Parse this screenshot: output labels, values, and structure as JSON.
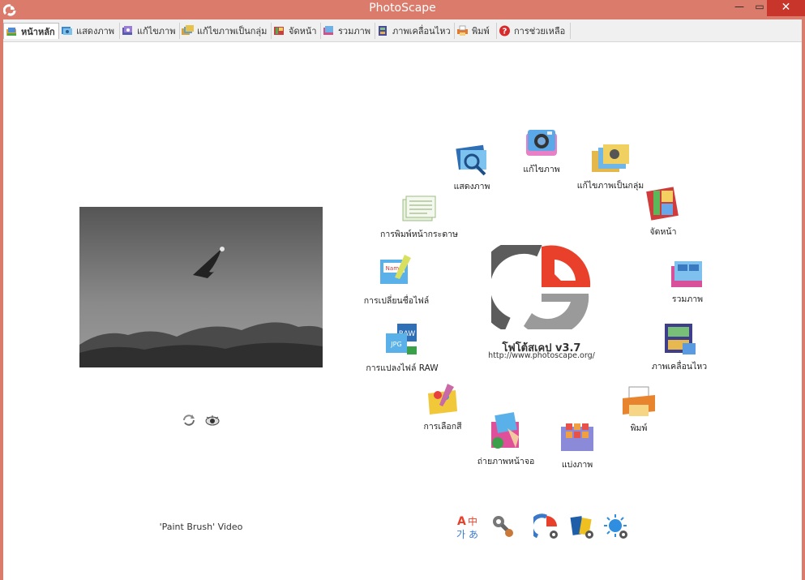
{
  "window": {
    "title": "PhotoScape",
    "min_label": "—",
    "max_label": "▭",
    "close_label": "✕"
  },
  "tabs": [
    {
      "label": "หน้าหลัก",
      "active": true
    },
    {
      "label": "แสดงภาพ"
    },
    {
      "label": "แก้ไขภาพ"
    },
    {
      "label": "แก้ไขภาพเป็นกลุ่ม"
    },
    {
      "label": "จัดหน้า"
    },
    {
      "label": "รวมภาพ"
    },
    {
      "label": "ภาพเคลื่อนไหว"
    },
    {
      "label": "พิมพ์"
    },
    {
      "label": "การช่วยเหลือ"
    }
  ],
  "left_panel": {
    "caption": "'Paint Brush' Video",
    "refresh_icon": "refresh-icon",
    "view_icon": "eye-icon"
  },
  "features": [
    {
      "label": "แสดงภาพ",
      "icon": "viewer-icon"
    },
    {
      "label": "แก้ไขภาพ",
      "icon": "camera-editor-icon"
    },
    {
      "label": "แก้ไขภาพเป็นกลุ่ม",
      "icon": "batch-editor-icon"
    },
    {
      "label": "จัดหน้า",
      "icon": "page-layout-icon"
    },
    {
      "label": "รวมภาพ",
      "icon": "combine-icon"
    },
    {
      "label": "ภาพเคลื่อนไหว",
      "icon": "animated-gif-icon"
    },
    {
      "label": "พิมพ์",
      "icon": "print-icon"
    },
    {
      "label": "แบ่งภาพ",
      "icon": "splitter-icon"
    },
    {
      "label": "ถ่ายภาพหน้าจอ",
      "icon": "screen-capture-icon"
    },
    {
      "label": "การเลือกสี",
      "icon": "color-picker-icon"
    },
    {
      "label": "การแปลงไฟล์ RAW",
      "icon": "raw-converter-icon"
    },
    {
      "label": "การเปลี่ยนชื่อไฟล์",
      "icon": "rename-icon"
    },
    {
      "label": "การพิมพ์หน้ากระดาษ",
      "icon": "paper-print-icon"
    }
  ],
  "center": {
    "app_name": "โฟโต้สเคป v3.7",
    "url": "http://www.photoscape.org/"
  },
  "bottom_icons": [
    "language-icon",
    "tools-icon",
    "photoscape-logo-icon",
    "photoscape-x-icon",
    "sun-settings-icon"
  ],
  "colors": {
    "title_bar": "#db7b6b",
    "close_button": "#c7352b",
    "logo_red": "#e8402a",
    "logo_gray": "#8a8a8a"
  }
}
